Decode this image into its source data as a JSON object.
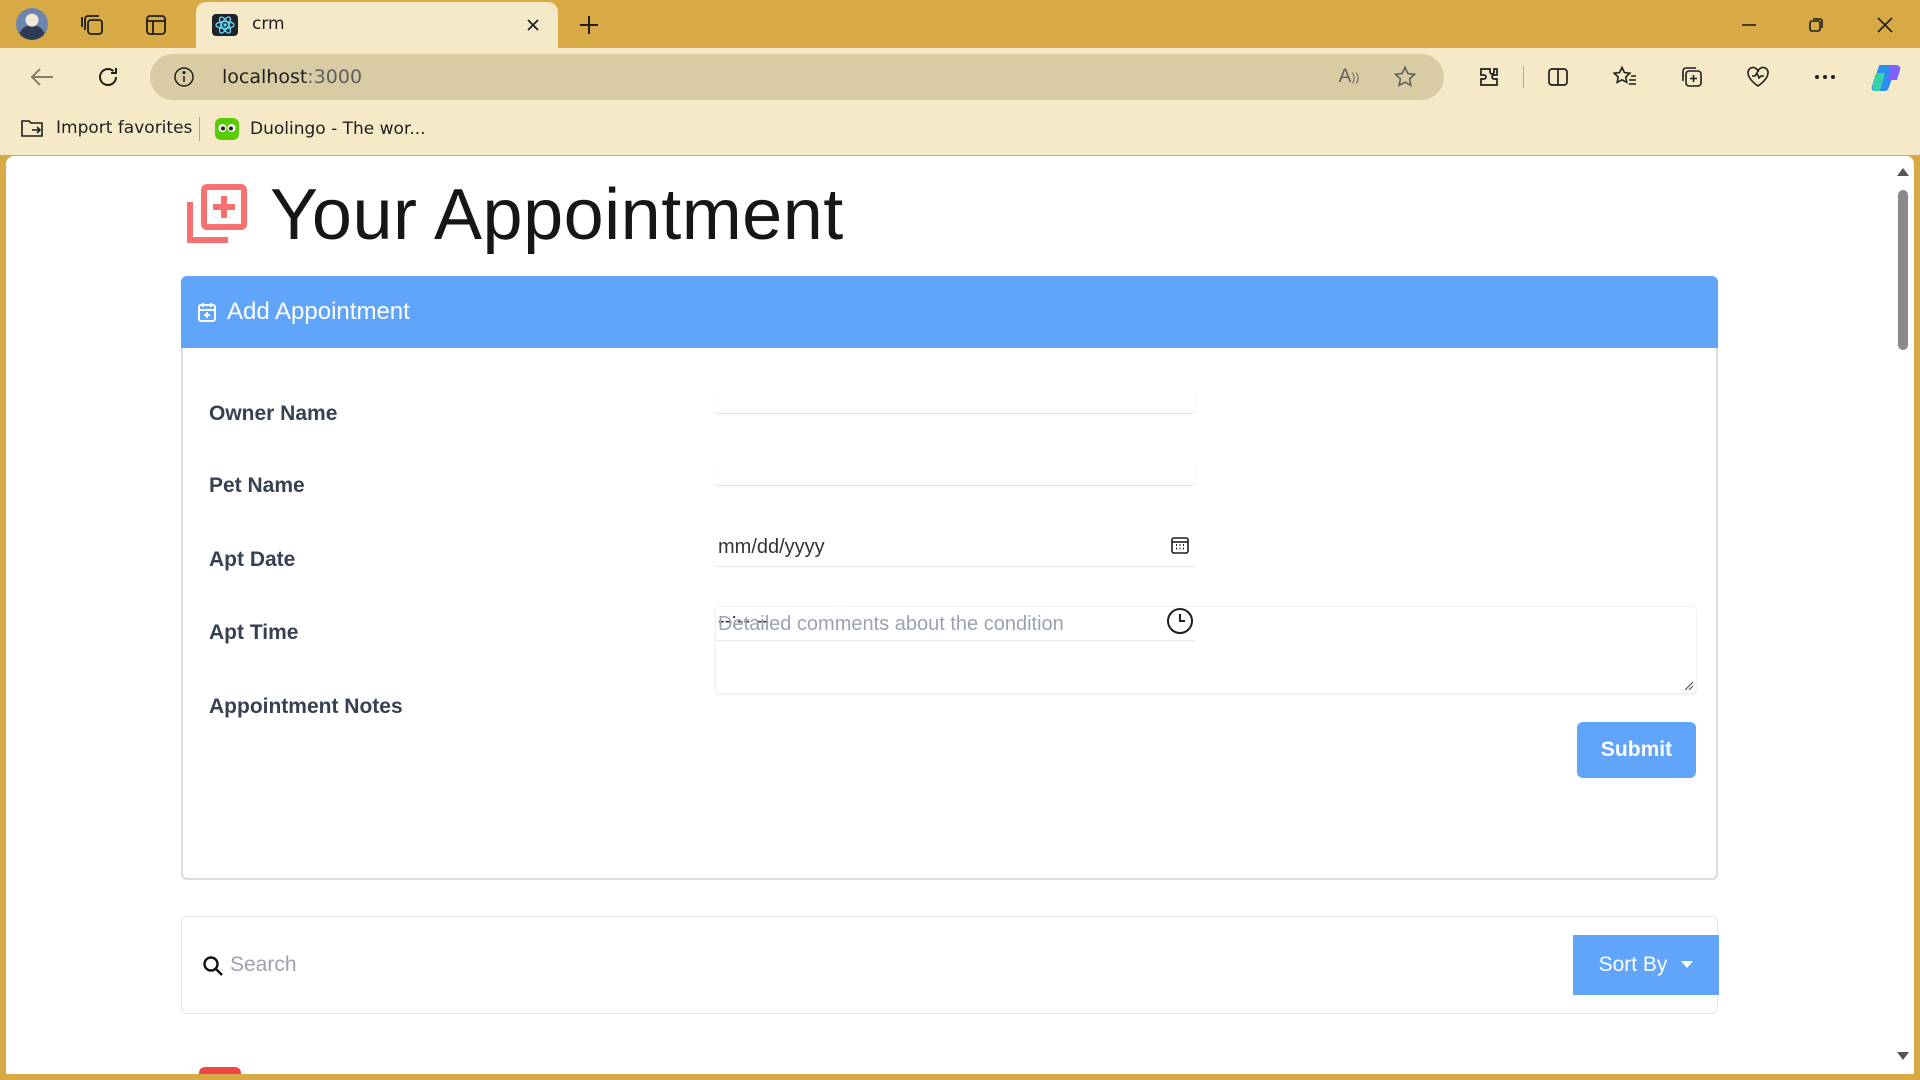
{
  "browser": {
    "tab_title": "crm",
    "url_host": "localhost",
    "url_port": ":3000",
    "favorites": [
      {
        "label": "Import favorites",
        "icon": "import-folder-icon"
      },
      {
        "label": "Duolingo - The wor...",
        "icon": "duolingo-icon"
      }
    ],
    "theme_color": "#d8aa46"
  },
  "page": {
    "heading": "Your Appointment",
    "heading_icon_color": "#f87171",
    "accent_color": "#60a5fa"
  },
  "form": {
    "header": "Add Appointment",
    "owner_label": "Owner Name",
    "pet_label": "Pet Name",
    "date_label": "Apt Date",
    "date_value": "mm/dd/yyyy",
    "time_label": "Apt Time",
    "time_value": "--:-- --",
    "notes_label": "Appointment Notes",
    "notes_placeholder": "Detailed comments about the condition",
    "submit_label": "Submit"
  },
  "search": {
    "placeholder": "Search",
    "sort_label": "Sort By"
  }
}
